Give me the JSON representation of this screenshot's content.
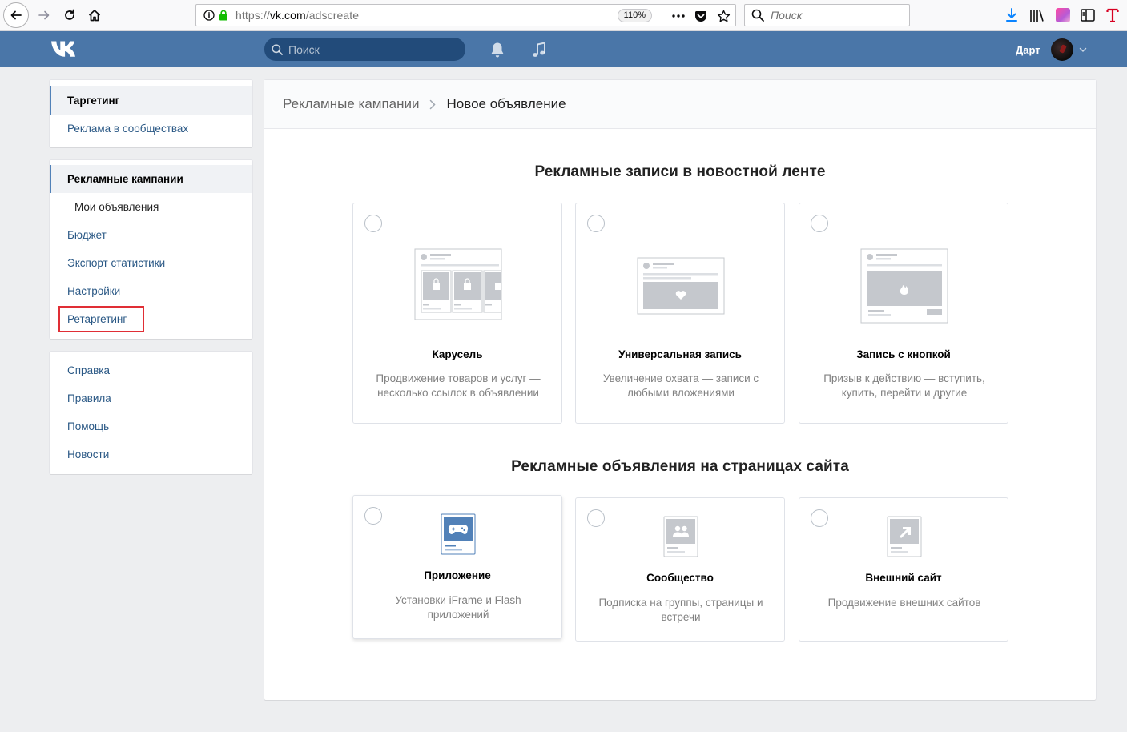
{
  "browser": {
    "url_prefix": "https://",
    "url_host": "vk.com",
    "url_path": "/adscreate",
    "zoom": "110%",
    "search_placeholder": "Поиск"
  },
  "header": {
    "search_placeholder": "Поиск",
    "user_name": "Дарт"
  },
  "sidebar": {
    "box1": [
      {
        "label": "Таргетинг",
        "active": true
      },
      {
        "label": "Реклама в сообществах"
      }
    ],
    "box2": [
      {
        "label": "Рекламные кампании",
        "active": true
      },
      {
        "label": "Мои объявления"
      },
      {
        "label": "Бюджет"
      },
      {
        "label": "Экспорт статистики"
      },
      {
        "label": "Настройки"
      },
      {
        "label": "Ретаргетинг",
        "highlighted": true
      }
    ],
    "box3": [
      {
        "label": "Справка"
      },
      {
        "label": "Правила"
      },
      {
        "label": "Помощь"
      },
      {
        "label": "Новости"
      }
    ]
  },
  "main": {
    "breadcrumb": {
      "parent": "Рекламные кампании",
      "current": "Новое объявление"
    },
    "section1": {
      "title": "Рекламные записи в новостной ленте",
      "cards": [
        {
          "title": "Карусель",
          "description": "Продвижение товаров и услуг — несколько ссылок в объявлении",
          "icon": "carousel-illustration"
        },
        {
          "title": "Универсальная запись",
          "description": "Увеличение охвата — записи с любыми вложениями",
          "icon": "universal-post-illustration"
        },
        {
          "title": "Запись с кнопкой",
          "description": "Призыв к действию — вступить, купить, перейти и другие",
          "icon": "button-post-illustration"
        }
      ]
    },
    "section2": {
      "title": "Рекламные объявления на страницах сайта",
      "cards": [
        {
          "title": "Приложение",
          "description": "Установки iFrame и Flash приложений",
          "icon": "gamepad-icon"
        },
        {
          "title": "Сообщество",
          "description": "Подписка на группы, страницы и встречи",
          "icon": "community-icon"
        },
        {
          "title": "Внешний сайт",
          "description": "Продвижение внешних сайтов",
          "icon": "external-link-icon"
        }
      ]
    }
  },
  "colors": {
    "header": "#4a76a8",
    "link": "#2a5885",
    "highlight": "#e02e35",
    "app_icon": "#5181b8"
  }
}
